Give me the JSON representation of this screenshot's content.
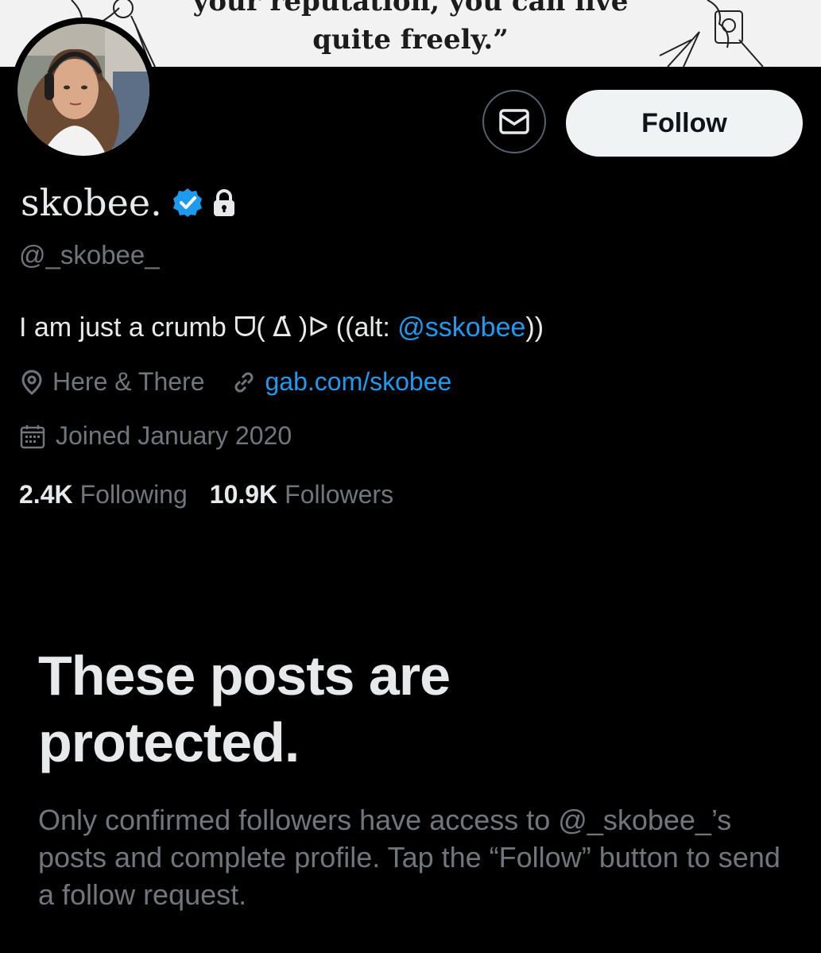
{
  "banner": {
    "line1": "your reputation, you can live",
    "line2": "quite freely.”"
  },
  "profile": {
    "display_name": "skobee.",
    "handle": "@_skobee_",
    "bio_text": "I am just a crumb ᗜ( ᐃ̇ )ᐅ ((alt: ",
    "bio_alt_handle": "@sskobee",
    "bio_close": "))",
    "location": "Here & There",
    "website": "gab.com/skobee",
    "joined": "Joined January 2020",
    "following_count": "2.4K",
    "following_label": "Following",
    "followers_count": "10.9K",
    "followers_label": "Followers"
  },
  "actions": {
    "follow_label": "Follow"
  },
  "protected": {
    "title": "These posts are protected.",
    "body": "Only confirmed followers have access to @_skobee_’s posts and complete profile. Tap the “Follow” button to send a follow request."
  },
  "colors": {
    "background": "#000000",
    "text_primary": "#e7e9ea",
    "text_secondary": "#71767b",
    "link": "#1d9bf0",
    "verified_badge": "#1d9bf0",
    "follow_button_bg": "#eff3f4"
  },
  "icons": {
    "message": "envelope-icon",
    "verified": "verified-badge-icon",
    "protected": "lock-icon",
    "location": "location-pin-icon",
    "website": "link-icon",
    "joined": "calendar-icon"
  }
}
